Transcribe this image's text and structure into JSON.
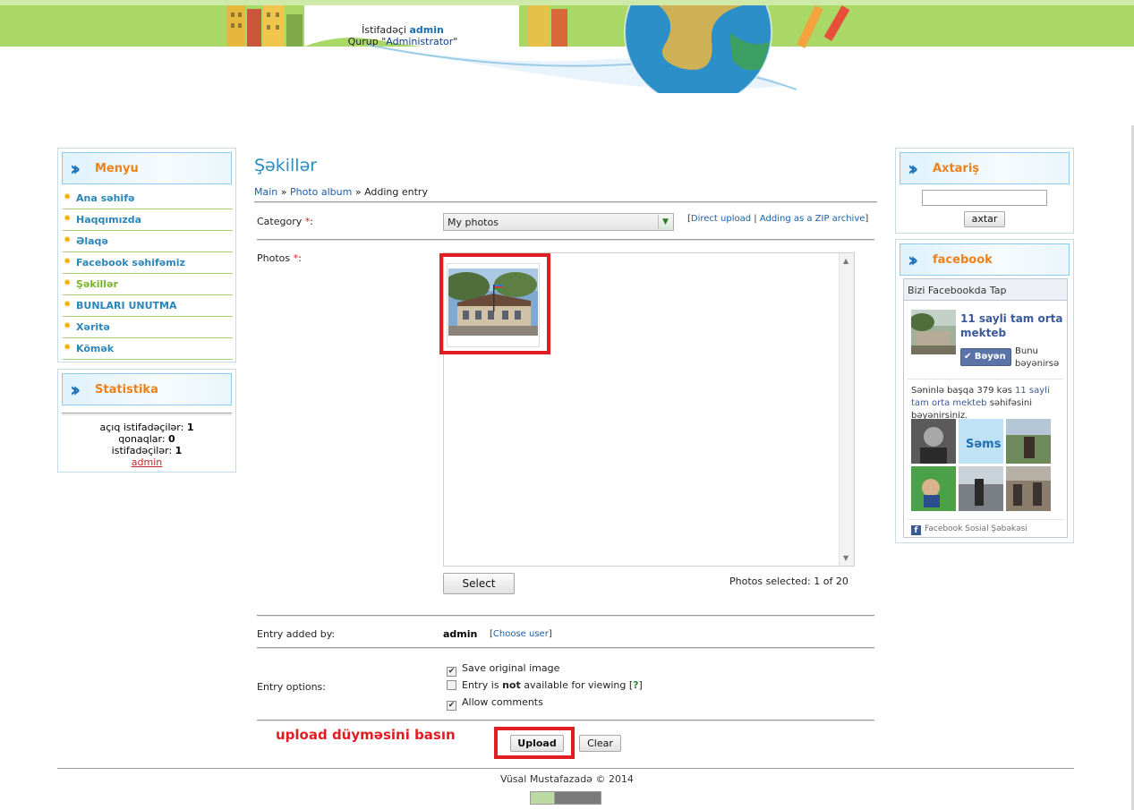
{
  "header": {
    "user_prefix": "İstifadəçi",
    "username": "admin",
    "group_prefix": "Qurup \"",
    "group_name": "Administrator",
    "group_suffix": "\""
  },
  "menu_box": {
    "title": "Menyu",
    "items": [
      {
        "label": "Ana səhifə"
      },
      {
        "label": "Haqqımızda"
      },
      {
        "label": "Əlaqə"
      },
      {
        "label": "Facebook səhifəmiz"
      },
      {
        "label": "Şəkillər"
      },
      {
        "label": "BUNLARI UNUTMA"
      },
      {
        "label": "Xəritə"
      },
      {
        "label": "Kömək"
      }
    ]
  },
  "stats_box": {
    "title": "Statistika",
    "open_users_label": "açıq istifadəçilər:",
    "open_users": "1",
    "guests_label": "qonaqlar:",
    "guests": "0",
    "users_label": "istifadəçilər:",
    "users": "1",
    "user_link": "admin"
  },
  "main": {
    "title": "Şəkillər",
    "breadcrumb": {
      "home": "Main",
      "sep": "»",
      "album": "Photo album",
      "current": "Adding entry"
    },
    "category_label": "Category",
    "required_mark": "*",
    "colon": ":",
    "category_value": "My photos",
    "link_direct_upload": "Direct upload",
    "link_zip_upload": "Adding as a ZIP archive",
    "link_separator": "|",
    "bracket_open": "[",
    "bracket_close": "]",
    "photos_label": "Photos",
    "select_button": "Select",
    "photos_selected": "Photos selected: 1 of 20",
    "entry_added_by_label": "Entry added by:",
    "entry_added_by_value": "admin",
    "choose_user": "Choose user",
    "entry_options_label": "Entry options:",
    "options": {
      "save_original": {
        "label": "Save original image",
        "checked": true
      },
      "not_available": {
        "pre": "Entry is ",
        "bold": "not",
        "post": " available for viewing ",
        "help": "?",
        "checked": false
      },
      "allow_comments": {
        "label": "Allow comments",
        "checked": true
      }
    },
    "note": "upload düyməsini basın",
    "upload_button": "Upload",
    "clear_button": "Clear",
    "highlight_color": "#e11d24"
  },
  "search_box": {
    "title": "Axtariş",
    "input_value": "",
    "button": "axtar"
  },
  "facebook_box": {
    "title": "facebook",
    "widget_header": "Bizi Facebookda Tap",
    "page_name": "11 sayli tam orta mekteb",
    "like_button": "Bəyən",
    "like_note": "Bunu bəyənirsə",
    "count_text_pre": "Səninlə başqa 379 kəs ",
    "count_text_link": "11 sayli tam orta mekteb",
    "count_text_post": " səhifəsini bəyənirsiniz.",
    "footer": "Facebook Sosial Şəbəkəsi",
    "brand_color": "#3b5998"
  },
  "footer": {
    "copyright": "Vüsal Mustafazadə © 2014"
  },
  "colors": {
    "header_green": "#a9d866",
    "title_blue": "#2a8cc4",
    "box_title_orange": "#f08119",
    "menu_link": "#2a86b8",
    "menu_active": "#78b32d"
  }
}
